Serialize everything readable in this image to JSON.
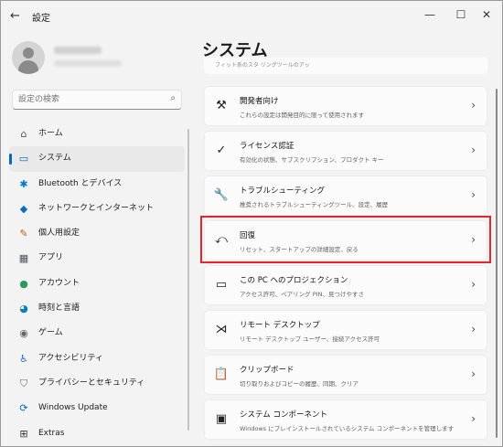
{
  "window": {
    "title": "設定",
    "back_icon": "arrow-left-icon"
  },
  "search": {
    "placeholder": "設定の検索"
  },
  "nav": [
    {
      "label": "ホーム",
      "icon": "home-icon",
      "glyph": "⌂",
      "color": "#555555"
    },
    {
      "label": "システム",
      "icon": "monitor-icon",
      "glyph": "▭",
      "color": "#0067c0",
      "selected": true
    },
    {
      "label": "Bluetooth とデバイス",
      "icon": "bluetooth-icon",
      "glyph": "✱",
      "color": "#0078d4"
    },
    {
      "label": "ネットワークとインターネット",
      "icon": "wifi-icon",
      "glyph": "◆",
      "color": "#0f6cbd"
    },
    {
      "label": "個人用設定",
      "icon": "brush-icon",
      "glyph": "✎",
      "color": "#c65a12"
    },
    {
      "label": "アプリ",
      "icon": "apps-icon",
      "glyph": "▦",
      "color": "#4a5360"
    },
    {
      "label": "アカウント",
      "icon": "account-icon",
      "glyph": "●",
      "color": "#2d9b57"
    },
    {
      "label": "時刻と言語",
      "icon": "globe-clock-icon",
      "glyph": "◕",
      "color": "#0f7fb3"
    },
    {
      "label": "ゲーム",
      "icon": "game-controller-icon",
      "glyph": "◉",
      "color": "#666666"
    },
    {
      "label": "アクセシビリティ",
      "icon": "accessibility-icon",
      "glyph": "♿",
      "color": "#1a73c8"
    },
    {
      "label": "プライバシーとセキュリティ",
      "icon": "shield-icon",
      "glyph": "⛉",
      "color": "#5f6b74"
    },
    {
      "label": "Windows Update",
      "icon": "update-icon",
      "glyph": "⟳",
      "color": "#0067c0"
    },
    {
      "label": "Extras",
      "icon": "extras-icon",
      "glyph": "⊞",
      "color": "#333333"
    }
  ],
  "main": {
    "title": "システム",
    "cut_text": "フィット系のスタ リングツールのアッ",
    "cards": [
      {
        "title": "開発者向け",
        "subtitle": "これらの設定は開発目的に限って使用されます",
        "icon": "developer-tools-icon",
        "glyph": "⚒"
      },
      {
        "title": "ライセンス認証",
        "subtitle": "有効化の状態、サブスクリプション、プロダクト キー",
        "icon": "check-circle-icon",
        "glyph": "✓"
      },
      {
        "title": "トラブルシューティング",
        "subtitle": "推奨されるトラブルシューティングツール、設定、履歴",
        "icon": "wrench-icon",
        "glyph": "🔧"
      },
      {
        "title": "回復",
        "subtitle": "リセット、スタートアップの詳細設定、戻る",
        "icon": "recovery-icon",
        "glyph": "⤺"
      },
      {
        "title": "この PC へのプロジェクション",
        "subtitle": "アクセス許可、ペアリング PIN、見つけやすさ",
        "icon": "projection-icon",
        "glyph": "▭"
      },
      {
        "title": "リモート デスクトップ",
        "subtitle": "リモート デスクトップ ユーザー、接続アクセス許可",
        "icon": "remote-desktop-icon",
        "glyph": "⋊"
      },
      {
        "title": "クリップボード",
        "subtitle": "切り取りおよびコピーの履歴、同期、クリア",
        "icon": "clipboard-icon",
        "glyph": "📋"
      },
      {
        "title": "システム コンポーネント",
        "subtitle": "Windows にプレインストールされているシステム コンポーネントを管理します",
        "icon": "system-component-icon",
        "glyph": "▣"
      }
    ]
  },
  "highlight_color": "#e3262e"
}
